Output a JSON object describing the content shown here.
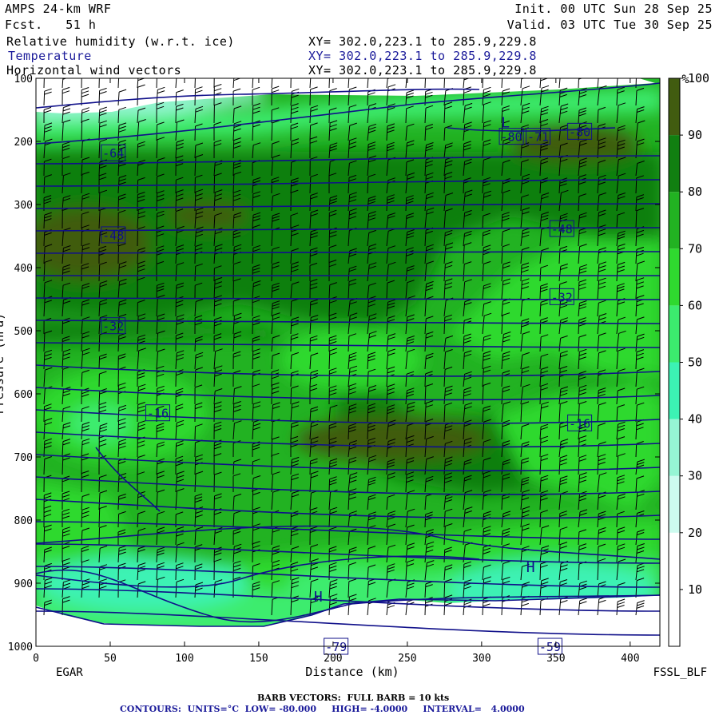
{
  "header": {
    "model": "AMPS 24-km WRF",
    "fcst": "Fcst.   51 h",
    "init": "Init. 00 UTC Sun 28 Sep 25",
    "valid": "Valid. 03 UTC Tue 30 Sep 25",
    "field1": "Relative humidity (w.r.t. ice)",
    "field2": "Temperature",
    "field3": "Horizontal wind vectors",
    "xs1": "XY= 302.0,223.1 to 285.9,229.8",
    "xs2": "XY= 302.0,223.1 to 285.9,229.8",
    "xs3": "XY= 302.0,223.1 to 285.9,229.8"
  },
  "footer": {
    "left_label": "EGAR",
    "right_label": "FSSL_BLF",
    "barb_note": "BARB VECTORS:  FULL BARB = 10 kts",
    "contours": "CONTOURS:  UNITS=°C  LOW= -80.000     HIGH= -4.0000     INTERVAL=   4.0000"
  },
  "colors": {
    "temp_contour": "#10108a",
    "colorbar": [
      "#ffffff",
      "#ffffff",
      "#cdfbef",
      "#96f5d4",
      "#3cf2b4",
      "#3cec6e",
      "#2fd92f",
      "#22b222",
      "#117f11",
      "#415c10"
    ]
  },
  "chart_data": {
    "type": "heatmap",
    "xlabel": "Distance (km)",
    "ylabel": "Pressure (hPa)",
    "xlim": [
      0,
      420
    ],
    "ylim": [
      1000,
      100
    ],
    "x_ticks": [
      0,
      50,
      100,
      150,
      200,
      250,
      300,
      350,
      400
    ],
    "y_ticks": [
      100,
      200,
      300,
      400,
      500,
      600,
      700,
      800,
      900,
      1000
    ],
    "colorbar": {
      "unit": "%",
      "ticks": [
        10,
        20,
        30,
        40,
        50,
        60,
        70,
        80,
        90,
        100
      ],
      "bounds": [
        0,
        10,
        20,
        30,
        40,
        50,
        60,
        70,
        80,
        90,
        100
      ]
    },
    "temperature_contours": {
      "units": "°C",
      "low": -80,
      "high": -4,
      "interval": 4,
      "labels": [
        {
          "text": "-64",
          "x": 52,
          "p": 218
        },
        {
          "text": "-48",
          "x": 52,
          "p": 348
        },
        {
          "text": "-32",
          "x": 52,
          "p": 492
        },
        {
          "text": "-16",
          "x": 82,
          "p": 630
        },
        {
          "text": "-80",
          "x": 366,
          "p": 184
        },
        {
          "text": "-80",
          "x": 320,
          "p": 192
        },
        {
          "text": "-71",
          "x": 338,
          "p": 192
        },
        {
          "text": "-48",
          "x": 354,
          "p": 338
        },
        {
          "text": "-32",
          "x": 354,
          "p": 446
        },
        {
          "text": "-16",
          "x": 366,
          "p": 646
        },
        {
          "text": "-59",
          "x": 346,
          "p": 1000
        },
        {
          "text": "-79",
          "x": 202,
          "p": 1000
        }
      ],
      "extrema": [
        {
          "text": "L",
          "x": 316,
          "p": 178
        },
        {
          "text": "H",
          "x": 333,
          "p": 882
        },
        {
          "text": "H",
          "x": 190,
          "p": 929
        }
      ]
    },
    "wind_barbs": {
      "full_barb_kts": 10
    }
  }
}
